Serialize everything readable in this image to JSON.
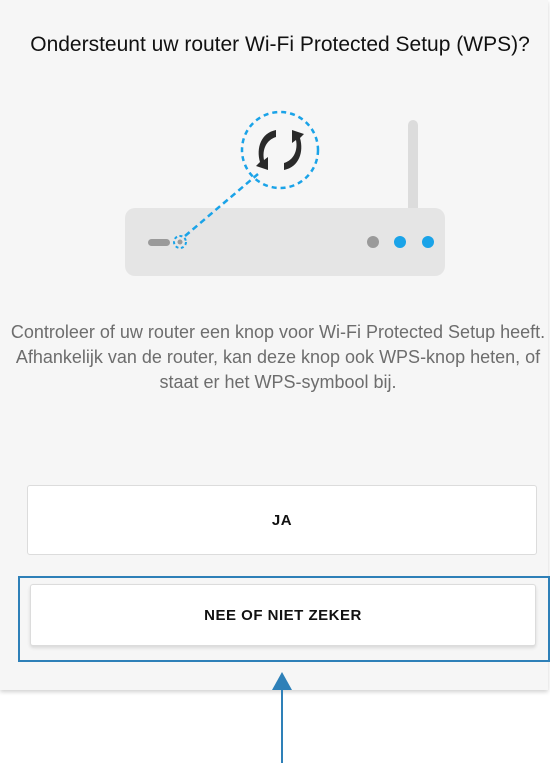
{
  "title": "Ondersteunt uw router Wi-Fi Protected Setup (WPS)?",
  "description": "Controleer of uw router een knop voor Wi-Fi Protected Setup heeft. Afhankelijk van de router, kan deze knop ook WPS-knop heten, of staat er het WPS-symbool bij.",
  "buttons": {
    "yes_label": "JA",
    "no_label": "NEE OF NIET ZEKER"
  },
  "illustration": {
    "icon": "wps-icon",
    "device": "router-icon",
    "accent_color": "#1aa3e8"
  },
  "annotation": {
    "highlight_color": "#2e80b8",
    "arrow_icon": "arrow-up-icon"
  }
}
